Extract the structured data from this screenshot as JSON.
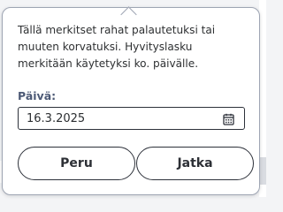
{
  "dialog": {
    "message": "Tällä merkitset rahat palautetuksi tai\nmuuten korvatuksi. Hyvityslasku\nmerkitään käytetyksi ko. päivälle.",
    "date_label": "Päivä:",
    "date_value": "16.3.2025",
    "date_icon": "calendar-icon",
    "cancel_label": "Peru",
    "continue_label": "Jatka"
  }
}
